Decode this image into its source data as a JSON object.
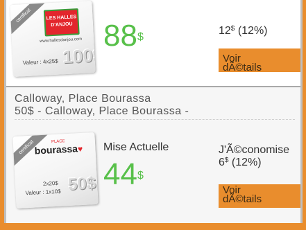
{
  "deal1": {
    "card": {
      "ribbon": "certificat",
      "logo_line1": "LES HALLES",
      "logo_line2": "D'ANJOU",
      "logo_url": "www.hallesdanjou.com",
      "value_text": "Valeur : 4x25$",
      "big_value": "100$"
    },
    "price": "88",
    "price_currency": "$",
    "savings_amount": "12",
    "savings_currency": "$",
    "savings_percent": "(12%)",
    "button": "Voir dÃ©tails"
  },
  "deal2": {
    "title": "Calloway, Place Bourassa",
    "subtitle": "50$ - Calloway, Place Bourassa -",
    "card": {
      "ribbon": "certificat",
      "logo_sub": "PLACE",
      "logo_text": "bourassa",
      "value_text_1": "2x20$",
      "value_text_2": "Valeur : 1x10$",
      "big_value": "50$"
    },
    "current_label": "Mise Actuelle",
    "price": "44",
    "price_currency": "$",
    "savings_label": "J'Ã©conomise",
    "savings_amount": "6",
    "savings_currency": "$",
    "savings_percent": "(12%)",
    "button": "Voir dÃ©tails"
  },
  "colors": {
    "accent": "#e98d2d",
    "price_green": "#58c04a"
  }
}
